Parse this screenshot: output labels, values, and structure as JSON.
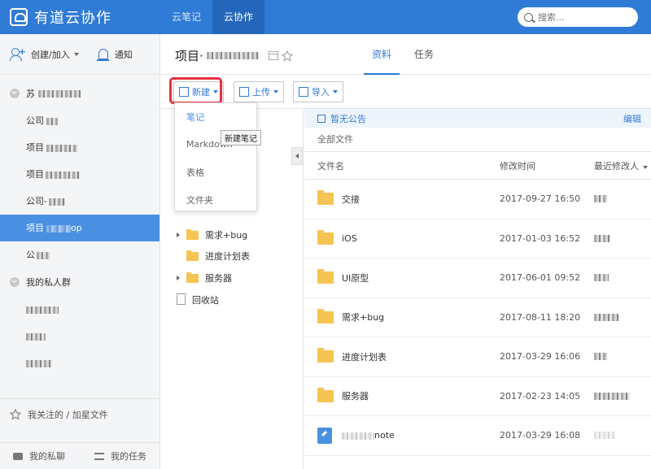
{
  "app": {
    "title": "有道云协作"
  },
  "topnav": {
    "items": [
      {
        "label": "云笔记"
      },
      {
        "label": "云协作"
      }
    ],
    "active": "云协作"
  },
  "search": {
    "placeholder": "搜索..."
  },
  "sidebar": {
    "create_label": "创建/加入",
    "notify_label": "通知",
    "group_name": "苏",
    "items": [
      {
        "label": "公司"
      },
      {
        "label": "项目"
      },
      {
        "label": "项目"
      },
      {
        "label": "公司-"
      },
      {
        "label": "项目",
        "suffix": "op"
      },
      {
        "label": "公"
      }
    ],
    "private_group_label": "我的私人群",
    "favorites_label": "我关注的 / 加星文件",
    "bottom": {
      "chat_label": "我的私聊",
      "task_label": "我的任务"
    }
  },
  "project": {
    "title": "项目·"
  },
  "tabs": [
    {
      "label": "资料"
    },
    {
      "label": "任务"
    }
  ],
  "toolbar": {
    "new_label": "新建",
    "upload_label": "上传",
    "import_label": "导入"
  },
  "dropdown": {
    "items": [
      {
        "label": "笔记"
      },
      {
        "label": "Markdown"
      },
      {
        "label": "表格"
      },
      {
        "label": "文件夹"
      }
    ],
    "tooltip": "新建笔记"
  },
  "tree": {
    "items": [
      {
        "label": "需求+bug"
      },
      {
        "label": "进度计划表"
      },
      {
        "label": "服务器"
      },
      {
        "label": "回收站"
      }
    ]
  },
  "notice": {
    "text": "暂无公告",
    "edit": "编辑"
  },
  "files": {
    "breadcrumb": "全部文件",
    "columns": {
      "name": "文件名",
      "modified": "修改时间",
      "modifier": "最近修改人"
    },
    "rows": [
      {
        "name": "交接",
        "modified": "2017-09-27 16:50",
        "type": "folder"
      },
      {
        "name": "iOS",
        "modified": "2017-01-03 16:52",
        "type": "folder"
      },
      {
        "name": "UI原型",
        "modified": "2017-06-01 09:52",
        "type": "folder"
      },
      {
        "name": "需求+bug",
        "modified": "2017-08-11 18:20",
        "type": "folder"
      },
      {
        "name": "进度计划表",
        "modified": "2017-03-29 16:06",
        "type": "folder"
      },
      {
        "name": "服务器",
        "modified": "2017-02-23 14:05",
        "type": "folder"
      },
      {
        "name": "note",
        "modified": "2017-03-29 16:08",
        "type": "note"
      }
    ]
  },
  "colors": {
    "primary": "#2f7bd6",
    "active_item": "#4a90e2",
    "highlight": "#e8313f",
    "folder": "#f6c452"
  }
}
